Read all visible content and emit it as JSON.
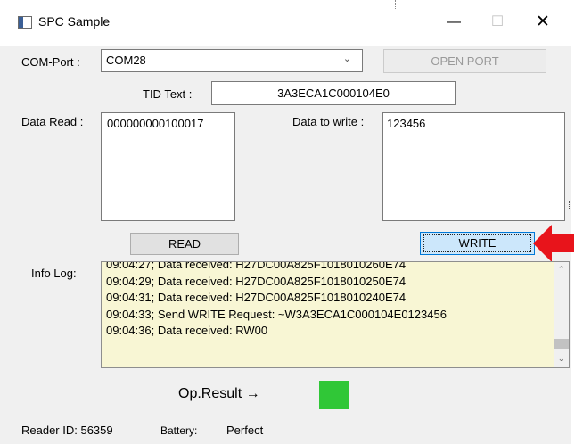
{
  "window": {
    "title": "SPC Sample",
    "icon": "app-window-icon",
    "controls": {
      "minimize": "—",
      "maximize": "☐",
      "close": "✕"
    }
  },
  "com": {
    "label": "COM-Port :",
    "selected": "COM28",
    "chevron": "⌄",
    "open_button": "OPEN PORT"
  },
  "tid": {
    "label": "TID Text :",
    "value": "3A3ECA1C000104E0"
  },
  "data_read": {
    "label": "Data Read :",
    "value": "000000000100017"
  },
  "data_write": {
    "label": "Data to write :",
    "value": "123456"
  },
  "buttons": {
    "read": "READ",
    "write": "WRITE"
  },
  "info_log": {
    "label": "Info Log:",
    "lines": [
      "09:04:27; Data received: H27DC00A825F1018010260E74",
      "09:04:29; Data received: H27DC00A825F1018010250E74",
      "09:04:31; Data received: H27DC00A825F1018010240E74",
      "09:04:33; Send WRITE Request: ~W3A3ECA1C000104E0123456",
      "09:04:36; Data received: RW00"
    ],
    "scroll_up": "⌃",
    "scroll_down": "⌄"
  },
  "op_result": {
    "label": "Op.Result →",
    "status_color": "#30c737"
  },
  "status": {
    "reader_id": "Reader ID: 56359",
    "battery_label": "Battery:",
    "battery_value": "Perfect"
  },
  "annotation": {
    "arrow_color": "#e8141b"
  }
}
